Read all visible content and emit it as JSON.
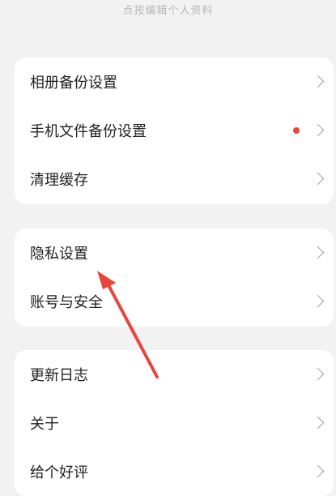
{
  "header": {
    "hint": "点按编辑个人资料"
  },
  "groups": [
    {
      "items": [
        {
          "label": "相册备份设置"
        },
        {
          "label": "手机文件备份设置",
          "has_dot": true
        },
        {
          "label": "清理缓存"
        }
      ]
    },
    {
      "items": [
        {
          "label": "隐私设置"
        },
        {
          "label": "账号与安全"
        }
      ]
    },
    {
      "items": [
        {
          "label": "更新日志"
        },
        {
          "label": "关于"
        },
        {
          "label": "给个好评"
        }
      ]
    }
  ],
  "icons": {
    "chevron": "chevron-right-icon",
    "dot": "notification-dot-icon",
    "annotation": "red-arrow-annotation"
  },
  "colors": {
    "background": "#f2f2f2",
    "card": "#ffffff",
    "text": "#222222",
    "hint": "#b8b8b8",
    "chevron": "#9a9a9a",
    "dot": "#e8453c",
    "arrow": "#e8453c"
  }
}
